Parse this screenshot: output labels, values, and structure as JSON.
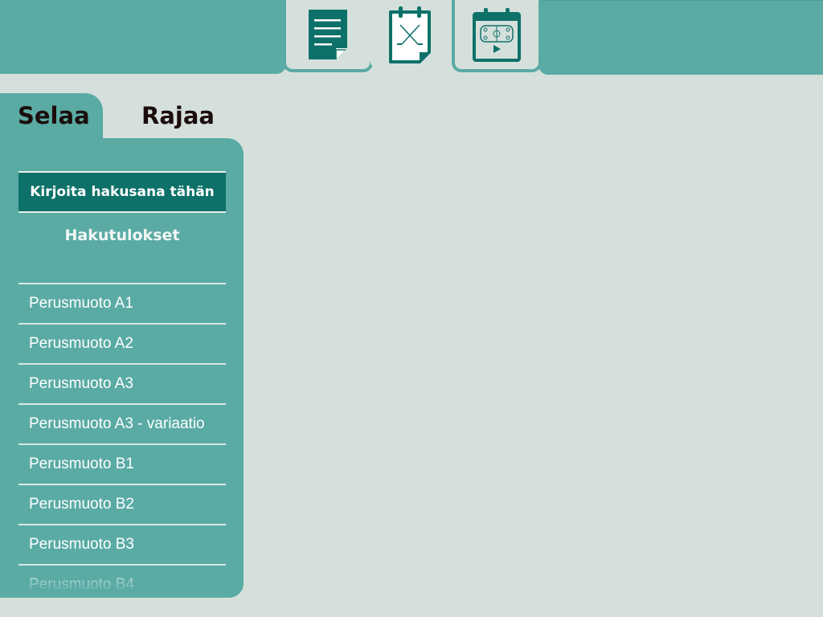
{
  "nav": {
    "tabs": [
      {
        "name": "document",
        "icon": "document-icon"
      },
      {
        "name": "hockey-plan",
        "icon": "hockey-sticks-clipboard-icon"
      },
      {
        "name": "calendar-rink",
        "icon": "calendar-rink-icon"
      }
    ]
  },
  "panel_tabs": {
    "browse": "Selaa",
    "filter": "Rajaa"
  },
  "search": {
    "placeholder": "Kirjoita hakusana tähän"
  },
  "results": {
    "title": "Hakutulokset",
    "items": [
      "Perusmuoto A1",
      "Perusmuoto A2",
      "Perusmuoto A3",
      "Perusmuoto A3 - variaatio",
      "Perusmuoto B1",
      "Perusmuoto B2",
      "Perusmuoto B3",
      "Perusmuoto B4"
    ]
  },
  "colors": {
    "accent": "#5aaba4",
    "dark_accent": "#0e7169",
    "background": "#d5e0dc"
  }
}
